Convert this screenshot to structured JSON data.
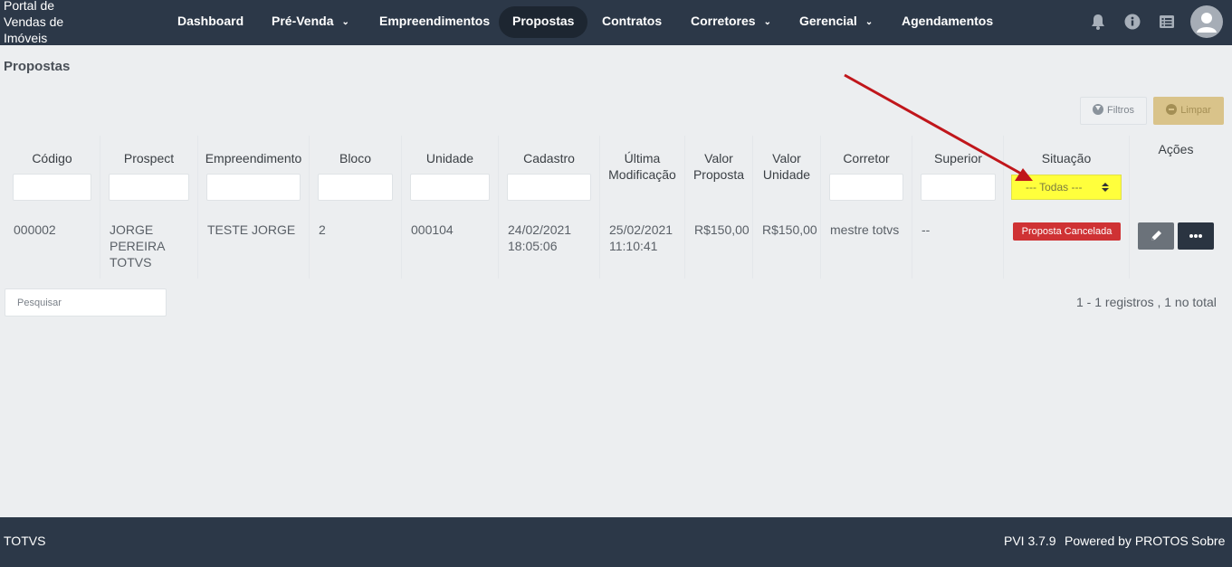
{
  "brand": {
    "text": "Portal de Vendas de Imóveis"
  },
  "nav": {
    "dashboard": "Dashboard",
    "pre_venda": "Pré-Venda",
    "empreendimentos": "Empreendimentos",
    "propostas": "Propostas",
    "contratos": "Contratos",
    "corretores": "Corretores",
    "gerencial": "Gerencial",
    "agendamentos": "Agendamentos",
    "caret": "⌄"
  },
  "page": {
    "title": "Propostas"
  },
  "toolbar": {
    "filter_label": "Filtros",
    "clear_label": "Limpar"
  },
  "table": {
    "headers": {
      "codigo": "Código",
      "prospect": "Prospect",
      "empreendimento": "Empreendimento",
      "bloco": "Bloco",
      "unidade": "Unidade",
      "cadastro": "Cadastro",
      "ultima_modificacao_1": "Última",
      "ultima_modificacao_2": "Modificação",
      "valor_proposta_1": "Valor",
      "valor_proposta_2": "Proposta",
      "valor_unidade_1": "Valor",
      "valor_unidade_2": "Unidade",
      "corretor": "Corretor",
      "superior": "Superior",
      "situacao": "Situação",
      "acoes": "Ações"
    },
    "situacao_selected": "--- Todas ---",
    "rows": [
      {
        "codigo": "000002",
        "prospect_1": "JORGE",
        "prospect_2": "PEREIRA",
        "prospect_3": "TOTVS",
        "empreendimento": "TESTE JORGE",
        "bloco": "2",
        "unidade": "000104",
        "cadastro_date": "24/02/2021",
        "cadastro_time": "18:05:06",
        "modificacao_date": "25/02/2021",
        "modificacao_time": "11:10:41",
        "valor_proposta": "R$150,00",
        "valor_unidade": "R$150,00",
        "corretor": "mestre totvs",
        "superior": "--",
        "situacao": "Proposta Cancelada"
      }
    ]
  },
  "search": {
    "placeholder": "Pesquisar"
  },
  "pagination": {
    "info": "1 - 1 registros , 1 no total"
  },
  "footer": {
    "company": "TOTVS",
    "version": "PVI 3.7.9",
    "powered": "Powered by PROTOS",
    "about": "Sobre"
  },
  "colors": {
    "navbar": "#2c3848",
    "status_cancelada": "#cf3234",
    "highlight": "#ffff3c",
    "annotation_arrow": "#c0161b",
    "clear_button": "#d9c38a"
  },
  "icons": [
    "bell-icon",
    "info-icon",
    "list-icon",
    "user-avatar-icon",
    "filter-icon",
    "minus-icon",
    "pencil-icon",
    "dots-icon",
    "sort-arrows-icon"
  ]
}
